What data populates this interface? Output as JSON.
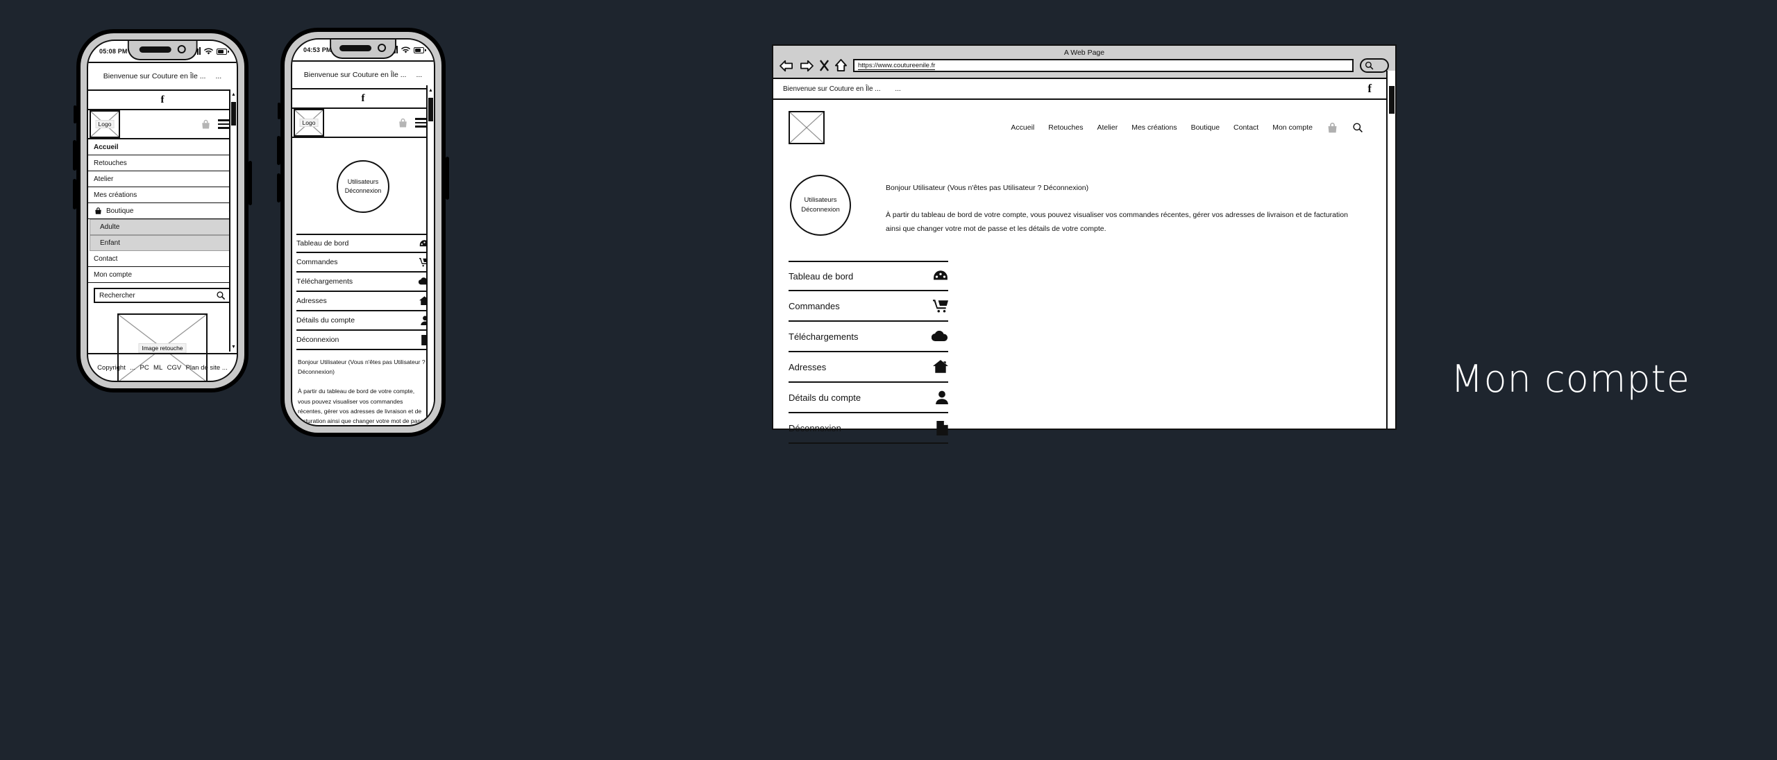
{
  "canvas": {
    "background": "#1e252e",
    "label": "Mon compte",
    "label_color": "#ffffff"
  },
  "phone1": {
    "status": {
      "time": "05:08 PM",
      "signal": "signal-bars",
      "wifi": "wifi-icon",
      "battery": "battery-icon"
    },
    "site_title": "Bienvenue sur Couture en Île ...",
    "title_ellipsis": "...",
    "facebook": "f",
    "logo_label": "Logo",
    "menu": [
      {
        "label": "Accueil",
        "bold": true,
        "type": "item"
      },
      {
        "label": "Retouches",
        "bold": false,
        "type": "item"
      },
      {
        "label": "Atelier",
        "bold": false,
        "type": "item"
      },
      {
        "label": "Mes créations",
        "bold": false,
        "type": "item"
      },
      {
        "label": "Boutique",
        "bold": false,
        "type": "item",
        "icon": "shopping-bag-icon",
        "suffix": "-"
      },
      {
        "label": "Adulte",
        "bold": false,
        "type": "sub"
      },
      {
        "label": "Enfant",
        "bold": false,
        "type": "sub"
      },
      {
        "label": "Contact",
        "bold": false,
        "type": "item"
      },
      {
        "label": "Mon compte",
        "bold": false,
        "type": "item"
      }
    ],
    "search": {
      "placeholder": "Rechercher",
      "icon": "search-icon"
    },
    "image_label": "Image retouche",
    "footer": [
      "Copyright",
      "...",
      "PC",
      "ML",
      "CGV",
      "Plan de site ..."
    ]
  },
  "phone2": {
    "status": {
      "time": "04:53 PM",
      "signal": "signal-bars",
      "wifi": "wifi-icon",
      "battery": "battery-icon"
    },
    "site_title": "Bienvenue sur Couture en Île ...",
    "title_ellipsis": "...",
    "facebook": "f",
    "logo_label": "Logo",
    "avatar": {
      "line1": "Utilisateurs",
      "line2": "Déconnexion"
    },
    "account_menu": [
      {
        "label": "Tableau de bord",
        "icon": "dashboard-icon"
      },
      {
        "label": "Commandes",
        "icon": "shopping-cart-icon"
      },
      {
        "label": "Téléchargements",
        "icon": "cloud-icon"
      },
      {
        "label": "Adresses",
        "icon": "home-icon"
      },
      {
        "label": "Détails du compte",
        "icon": "user-icon"
      },
      {
        "label": "Déconnexion",
        "icon": "file-icon"
      }
    ],
    "greeting": "Bonjour Utilisateur (Vous n'êtes pas Utilisateur ? Déconnexion)",
    "intro": "À partir du tableau de bord de votre compte, vous pouvez visualiser vos commandes récentes, gérer vos adresses de livraison et de facturation ainsi que changer votre mot de passe et les détails de votre compte."
  },
  "browser": {
    "window_title": "A Web Page",
    "url": "https://www.coutureenile.fr",
    "toolbar_icons": [
      "back-arrow-icon",
      "forward-arrow-icon",
      "close-icon",
      "home-icon"
    ],
    "search_icon": "search-icon",
    "site_title": "Bienvenue sur Couture en Île ...",
    "title_ellipsis": "...",
    "facebook": "f",
    "logo_label": "Logo",
    "nav": [
      "Accueil",
      "Retouches",
      "Atelier",
      "Mes créations",
      "Boutique",
      "Contact",
      "Mon compte"
    ],
    "nav_icons": [
      "shopping-bag-icon",
      "search-icon"
    ],
    "avatar": {
      "line1": "Utilisateurs",
      "line2": "Déconnexion"
    },
    "greeting": "Bonjour Utilisateur (Vous n'êtes pas Utilisateur ? Déconnexion)",
    "intro": "À partir du tableau de bord de votre compte, vous pouvez visualiser vos commandes récentes, gérer vos adresses de livraison et de facturation ainsi que changer votre mot de passe et les détails de votre compte.",
    "account_menu": [
      {
        "label": "Tableau de bord",
        "icon": "dashboard-icon"
      },
      {
        "label": "Commandes",
        "icon": "shopping-cart-icon"
      },
      {
        "label": "Téléchargements",
        "icon": "cloud-icon"
      },
      {
        "label": "Adresses",
        "icon": "home-icon"
      },
      {
        "label": "Détails du compte",
        "icon": "user-icon"
      },
      {
        "label": "Déconnexion",
        "icon": "file-icon"
      }
    ]
  }
}
